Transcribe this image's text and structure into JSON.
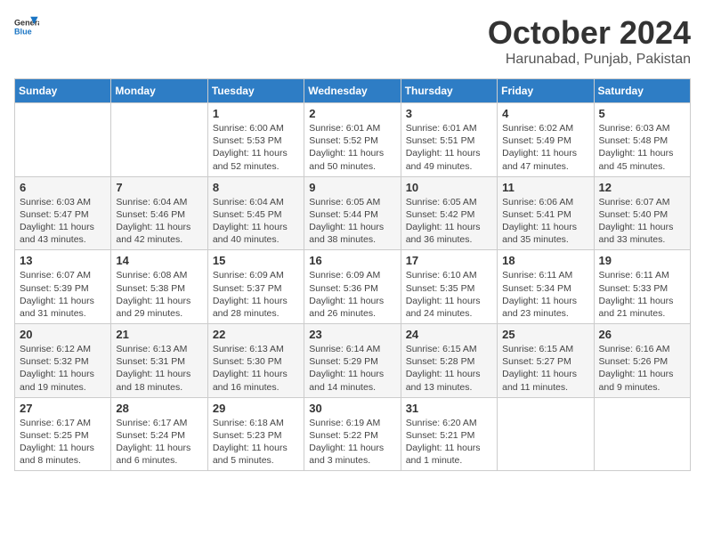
{
  "header": {
    "logo_line1": "General",
    "logo_line2": "Blue",
    "month": "October 2024",
    "location": "Harunabad, Punjab, Pakistan"
  },
  "weekdays": [
    "Sunday",
    "Monday",
    "Tuesday",
    "Wednesday",
    "Thursday",
    "Friday",
    "Saturday"
  ],
  "weeks": [
    [
      null,
      null,
      {
        "day": 1,
        "sunrise": "6:00 AM",
        "sunset": "5:53 PM",
        "daylight": "11 hours and 52 minutes."
      },
      {
        "day": 2,
        "sunrise": "6:01 AM",
        "sunset": "5:52 PM",
        "daylight": "11 hours and 50 minutes."
      },
      {
        "day": 3,
        "sunrise": "6:01 AM",
        "sunset": "5:51 PM",
        "daylight": "11 hours and 49 minutes."
      },
      {
        "day": 4,
        "sunrise": "6:02 AM",
        "sunset": "5:49 PM",
        "daylight": "11 hours and 47 minutes."
      },
      {
        "day": 5,
        "sunrise": "6:03 AM",
        "sunset": "5:48 PM",
        "daylight": "11 hours and 45 minutes."
      }
    ],
    [
      {
        "day": 6,
        "sunrise": "6:03 AM",
        "sunset": "5:47 PM",
        "daylight": "11 hours and 43 minutes."
      },
      {
        "day": 7,
        "sunrise": "6:04 AM",
        "sunset": "5:46 PM",
        "daylight": "11 hours and 42 minutes."
      },
      {
        "day": 8,
        "sunrise": "6:04 AM",
        "sunset": "5:45 PM",
        "daylight": "11 hours and 40 minutes."
      },
      {
        "day": 9,
        "sunrise": "6:05 AM",
        "sunset": "5:44 PM",
        "daylight": "11 hours and 38 minutes."
      },
      {
        "day": 10,
        "sunrise": "6:05 AM",
        "sunset": "5:42 PM",
        "daylight": "11 hours and 36 minutes."
      },
      {
        "day": 11,
        "sunrise": "6:06 AM",
        "sunset": "5:41 PM",
        "daylight": "11 hours and 35 minutes."
      },
      {
        "day": 12,
        "sunrise": "6:07 AM",
        "sunset": "5:40 PM",
        "daylight": "11 hours and 33 minutes."
      }
    ],
    [
      {
        "day": 13,
        "sunrise": "6:07 AM",
        "sunset": "5:39 PM",
        "daylight": "11 hours and 31 minutes."
      },
      {
        "day": 14,
        "sunrise": "6:08 AM",
        "sunset": "5:38 PM",
        "daylight": "11 hours and 29 minutes."
      },
      {
        "day": 15,
        "sunrise": "6:09 AM",
        "sunset": "5:37 PM",
        "daylight": "11 hours and 28 minutes."
      },
      {
        "day": 16,
        "sunrise": "6:09 AM",
        "sunset": "5:36 PM",
        "daylight": "11 hours and 26 minutes."
      },
      {
        "day": 17,
        "sunrise": "6:10 AM",
        "sunset": "5:35 PM",
        "daylight": "11 hours and 24 minutes."
      },
      {
        "day": 18,
        "sunrise": "6:11 AM",
        "sunset": "5:34 PM",
        "daylight": "11 hours and 23 minutes."
      },
      {
        "day": 19,
        "sunrise": "6:11 AM",
        "sunset": "5:33 PM",
        "daylight": "11 hours and 21 minutes."
      }
    ],
    [
      {
        "day": 20,
        "sunrise": "6:12 AM",
        "sunset": "5:32 PM",
        "daylight": "11 hours and 19 minutes."
      },
      {
        "day": 21,
        "sunrise": "6:13 AM",
        "sunset": "5:31 PM",
        "daylight": "11 hours and 18 minutes."
      },
      {
        "day": 22,
        "sunrise": "6:13 AM",
        "sunset": "5:30 PM",
        "daylight": "11 hours and 16 minutes."
      },
      {
        "day": 23,
        "sunrise": "6:14 AM",
        "sunset": "5:29 PM",
        "daylight": "11 hours and 14 minutes."
      },
      {
        "day": 24,
        "sunrise": "6:15 AM",
        "sunset": "5:28 PM",
        "daylight": "11 hours and 13 minutes."
      },
      {
        "day": 25,
        "sunrise": "6:15 AM",
        "sunset": "5:27 PM",
        "daylight": "11 hours and 11 minutes."
      },
      {
        "day": 26,
        "sunrise": "6:16 AM",
        "sunset": "5:26 PM",
        "daylight": "11 hours and 9 minutes."
      }
    ],
    [
      {
        "day": 27,
        "sunrise": "6:17 AM",
        "sunset": "5:25 PM",
        "daylight": "11 hours and 8 minutes."
      },
      {
        "day": 28,
        "sunrise": "6:17 AM",
        "sunset": "5:24 PM",
        "daylight": "11 hours and 6 minutes."
      },
      {
        "day": 29,
        "sunrise": "6:18 AM",
        "sunset": "5:23 PM",
        "daylight": "11 hours and 5 minutes."
      },
      {
        "day": 30,
        "sunrise": "6:19 AM",
        "sunset": "5:22 PM",
        "daylight": "11 hours and 3 minutes."
      },
      {
        "day": 31,
        "sunrise": "6:20 AM",
        "sunset": "5:21 PM",
        "daylight": "11 hours and 1 minute."
      },
      null,
      null
    ]
  ]
}
